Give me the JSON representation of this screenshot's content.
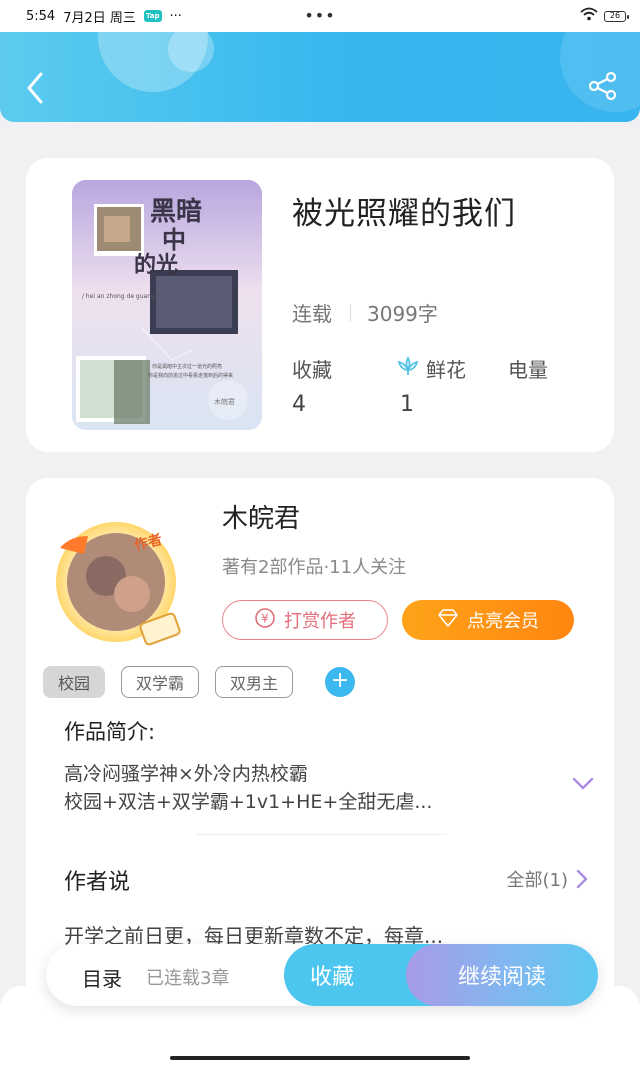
{
  "status_bar": {
    "time": "5:54",
    "date": "7月2日 周三",
    "app_badge": "Tap",
    "extra": "···",
    "center_dots": "•••",
    "battery": "26"
  },
  "header": {
    "back_icon": "chevron-left-icon",
    "share_icon": "share-icon",
    "gradient_colors": [
      "#5ccbef",
      "#38b4ee"
    ]
  },
  "book": {
    "title": "被光照耀的我们",
    "status": "连载",
    "word_count": "3099字",
    "stats": [
      {
        "label": "收藏",
        "value": "4"
      },
      {
        "label": "鲜花",
        "value": "1",
        "icon": "flower-icon"
      },
      {
        "label": "电量",
        "value": ""
      }
    ],
    "cover": {
      "title_art": "黑暗中的光",
      "subtitle_art": "/ hei an zhong de guang /",
      "caption_line1": "你是黑暗中主次过一道光的照亮",
      "caption_line2": "你是我向前追过中看看走落到后的得来",
      "seal": "木皖君"
    }
  },
  "author": {
    "name": "木皖君",
    "meta": "著有2部作品·11人关注",
    "avatar_badge": "作者",
    "reward_label": "打赏作者",
    "reward_icon": "yen-coin-icon",
    "vip_label": "点亮会员",
    "vip_icon": "diamond-icon",
    "accent_color": "#ff8f14"
  },
  "tags": {
    "items": [
      "校园",
      "双学霸",
      "双男主"
    ],
    "add_label": "+"
  },
  "intro": {
    "title": "作品简介:",
    "line1": "高冷闷骚学神×外冷内热校霸",
    "line2": "校园+双洁+双学霸+1v1+HE+全甜无虐..."
  },
  "author_says": {
    "title": "作者说",
    "all_label": "全部(1)",
    "text": "开学之前日更，每日更新章数不定，每章..."
  },
  "bottom_bar": {
    "toc_label": "目录",
    "serial_label": "已连载3章",
    "collect_label": "收藏",
    "read_label": "继续阅读"
  }
}
